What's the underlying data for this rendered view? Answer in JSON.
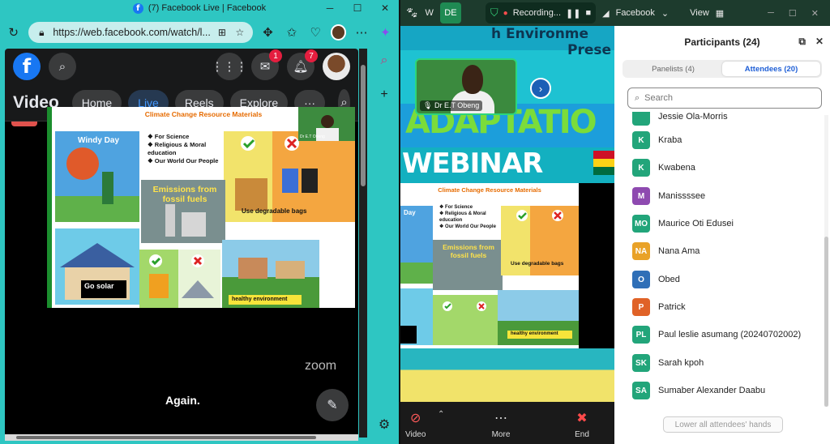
{
  "browser": {
    "tab_title": "(7) Facebook Live | Facebook",
    "url": "https://web.facebook.com/watch/l...",
    "icons": [
      "back-icon",
      "refresh-icon",
      "lock-icon",
      "star-icon",
      "extensions-icon",
      "favorites-icon",
      "heartbeat-icon",
      "profile-icon",
      "copilot-icon"
    ]
  },
  "facebook": {
    "brand_color": "#1877f2",
    "logo": "f",
    "messenger_badge": "1",
    "notifications_badge": "7",
    "section_title": "Video",
    "nav": [
      {
        "label": "Home"
      },
      {
        "label": "Live"
      },
      {
        "label": "Reels"
      },
      {
        "label": "Explore"
      },
      {
        "label": "···"
      }
    ],
    "slide": {
      "title": "Climate Change Resource Materials",
      "panels": [
        {
          "text": "Windy Day"
        },
        {
          "text": "❖ For Science\n❖ Religious & Moral education\n❖ Our World Our People"
        },
        {
          "text": "Emissions from fossil fuels"
        },
        {
          "text": "Use degradable bags"
        },
        {
          "text": "Go solar"
        },
        {
          "text": "healthy environment"
        }
      ],
      "inset_label": "Dr E.T Obeng"
    },
    "watermark": "zoom",
    "caption": "Again."
  },
  "zoom": {
    "accent": "#2cd67a",
    "host_initials": "DE",
    "recording_label": "Recording...",
    "stream_label": "Facebook",
    "view_label": "View",
    "banner": {
      "line1": "h Environme",
      "line1b": "Prese",
      "line2": "ADAPTATIO",
      "line3": "WEBINAR"
    },
    "stage_slide": {
      "title": "Climate Change Resource Materials",
      "panels": [
        "Day",
        "❖ For Science\n❖ Religious & Moral education\n❖ Our World Our People",
        "Emissions from fossil fuels",
        "Use degradable bags",
        "healthy environment"
      ]
    },
    "speaker_name": "Dr E.T Obeng",
    "toolbar": [
      {
        "label": "Video"
      },
      {
        "label": "More"
      },
      {
        "label": "End"
      }
    ]
  },
  "participants": {
    "title": "Participants (24)",
    "tabs": [
      {
        "label": "Panelists (4)"
      },
      {
        "label": "Attendees (20)"
      }
    ],
    "search_placeholder": "Search",
    "partial_name": "Jessie Ola-Morris",
    "list": [
      {
        "initials": "K",
        "name": "Kraba",
        "color": "#22a57a"
      },
      {
        "initials": "K",
        "name": "Kwabena",
        "color": "#22a57a"
      },
      {
        "initials": "M",
        "name": "Manissssee",
        "color": "#8e4ab0"
      },
      {
        "initials": "MO",
        "name": "Maurice Oti Edusei",
        "color": "#22a57a"
      },
      {
        "initials": "NA",
        "name": "Nana Ama",
        "color": "#e9a228"
      },
      {
        "initials": "O",
        "name": "Obed",
        "color": "#2f6fb7"
      },
      {
        "initials": "P",
        "name": "Patrick",
        "color": "#e06227"
      },
      {
        "initials": "PL",
        "name": "Paul leslie asumang (20240702002)",
        "color": "#22a57a"
      },
      {
        "initials": "SK",
        "name": "Sarah kpoh",
        "color": "#22a57a"
      },
      {
        "initials": "SA",
        "name": "Sumaber Alexander Daabu",
        "color": "#22a57a"
      }
    ],
    "lower_hands_label": "Lower all attendees' hands"
  }
}
